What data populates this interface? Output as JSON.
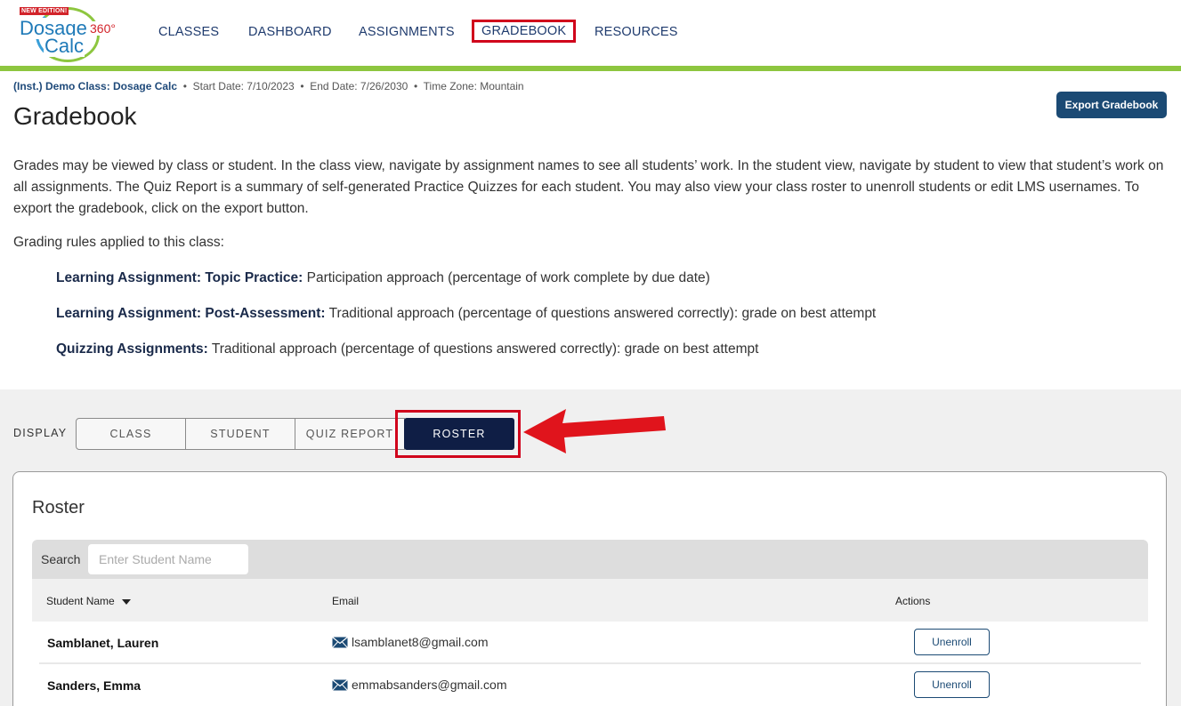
{
  "logo": {
    "badge": "NEW EDITION!",
    "word1": "Dosage",
    "word2": "Calc",
    "word3": "360°"
  },
  "nav": {
    "items": [
      "CLASSES",
      "DASHBOARD",
      "ASSIGNMENTS",
      "GRADEBOOK",
      "RESOURCES"
    ],
    "active": "GRADEBOOK"
  },
  "class_meta": {
    "class_name": "(Inst.) Demo Class: Dosage Calc",
    "start": "Start Date: 7/10/2023",
    "end": "End Date: 7/26/2030",
    "timezone": "Time Zone: Mountain",
    "separator": "•"
  },
  "page": {
    "title": "Gradebook",
    "export_label": "Export Gradebook",
    "intro": "Grades may be viewed by class or student. In the class view, navigate by assignment names to see all students’ work. In the student view, navigate by student to view that student’s work on all assignments. The Quiz Report is a summary of self-generated Practice Quizzes for each student. You may also view your class roster to unenroll students or edit LMS usernames. To export the gradebook, click on the export button.",
    "rules_heading": "Grading rules applied to this class:",
    "rules": [
      {
        "label": "Learning Assignment: Topic Practice:",
        "text": " Participation approach (percentage of work complete by due date)"
      },
      {
        "label": "Learning Assignment: Post-Assessment:",
        "text": " Traditional approach (percentage of questions answered correctly): grade on best attempt"
      },
      {
        "label": "Quizzing Assignments:",
        "text": " Traditional approach (percentage of questions answered correctly): grade on best attempt"
      }
    ]
  },
  "display": {
    "label": "DISPLAY",
    "options": [
      "CLASS",
      "STUDENT",
      "QUIZ REPORT",
      "ROSTER"
    ],
    "active": "ROSTER"
  },
  "roster": {
    "title": "Roster",
    "search_label": "Search",
    "search_placeholder": "Enter Student Name",
    "columns": [
      "Student Name",
      "Email",
      "Actions"
    ],
    "rows": [
      {
        "name": "Samblanet, Lauren",
        "email": "lsamblanet8@gmail.com",
        "action": "Unenroll"
      },
      {
        "name": "Sanders, Emma",
        "email": "emmabsanders@gmail.com",
        "action": "Unenroll"
      }
    ]
  },
  "colors": {
    "brand_navy": "#0f1e45",
    "button_blue": "#1b4a74",
    "green_bar": "#8dc63f",
    "highlight_red": "#d0021b"
  }
}
